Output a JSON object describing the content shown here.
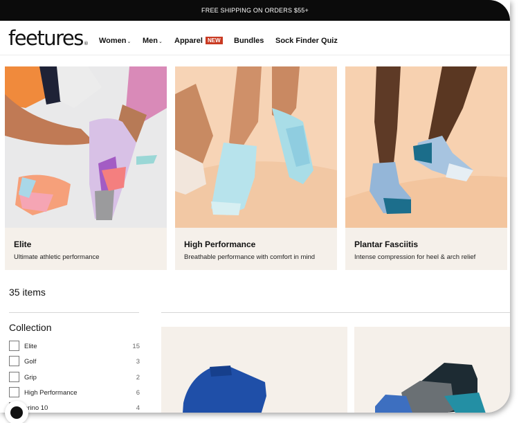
{
  "promo": {
    "text": "FREE SHIPPING ON ORDERS $55+"
  },
  "header": {
    "logo_text": "feetures",
    "logo_mark": "®",
    "nav": [
      {
        "label": "Women",
        "chevron": "⌄"
      },
      {
        "label": "Men",
        "chevron": "⌄"
      },
      {
        "label": "Apparel",
        "badge": "NEW"
      },
      {
        "label": "Bundles"
      },
      {
        "label": "Sock Finder Quiz"
      }
    ]
  },
  "collections": [
    {
      "title": "Elite",
      "description": "Ultimate athletic performance"
    },
    {
      "title": "High Performance",
      "description": "Breathable performance with comfort in mind"
    },
    {
      "title": "Plantar Fasciitis",
      "description": "Intense compression for heel & arch relief"
    }
  ],
  "results": {
    "count_label": "35 items"
  },
  "filters": {
    "title": "Collection",
    "options": [
      {
        "label": "Elite",
        "count": "15"
      },
      {
        "label": "Golf",
        "count": "3"
      },
      {
        "label": "Grip",
        "count": "2"
      },
      {
        "label": "High Performance",
        "count": "6"
      },
      {
        "label": "erino 10",
        "count": "4"
      }
    ]
  },
  "colors": {
    "accent_badge": "#c93a22",
    "card_bg": "#f5f0ea",
    "promo_bg": "#0b0b0b"
  }
}
